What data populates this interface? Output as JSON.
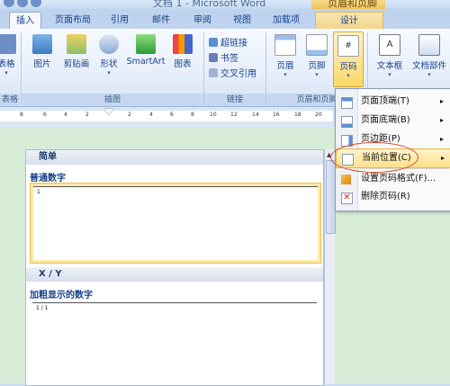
{
  "titlebar": {
    "title": "文档 1 - Microsoft Word",
    "context_tab": "页眉和页脚工具"
  },
  "tabs": [
    {
      "label": "插入"
    },
    {
      "label": "页面布局"
    },
    {
      "label": "引用"
    },
    {
      "label": "邮件"
    },
    {
      "label": "审阅"
    },
    {
      "label": "视图"
    },
    {
      "label": "加载项"
    },
    {
      "label": "设计"
    }
  ],
  "ribbon": {
    "groups": {
      "tables": "表格",
      "illustrations": "插图",
      "links": "链接",
      "header_footer": "页眉和页脚"
    },
    "buttons": {
      "table": "表格",
      "picture": "图片",
      "clipart": "剪贴画",
      "shapes": "形状",
      "smartart": "SmartArt",
      "chart": "图表",
      "hyperlink": "超链接",
      "bookmark": "书签",
      "cross_ref": "交叉引用",
      "header": "页眉",
      "footer": "页脚",
      "page_number": "页码",
      "textbox": "文本框",
      "quickparts": "文档部件"
    }
  },
  "ruler": {
    "labels": [
      "8",
      "6",
      "4",
      "2",
      "2",
      "4",
      "6",
      "8",
      "10",
      "12",
      "14",
      "16",
      "18",
      "20"
    ]
  },
  "gallery": {
    "section1": "简单",
    "item1_caption": "普通数字",
    "item1_text": "1",
    "section2": "X / Y",
    "item2_caption": "加粗显示的数字",
    "item2_text": "1 / 1"
  },
  "menu": {
    "items": [
      {
        "label": "页面顶端(T)",
        "arrow": "▸"
      },
      {
        "label": "页面底端(B)",
        "arrow": "▸"
      },
      {
        "label": "页边距(P)",
        "arrow": "▸"
      },
      {
        "label": "当前位置(C)",
        "arrow": "▸"
      },
      {
        "label": "设置页码格式(F)..."
      },
      {
        "label": "删除页码(R)"
      }
    ]
  }
}
